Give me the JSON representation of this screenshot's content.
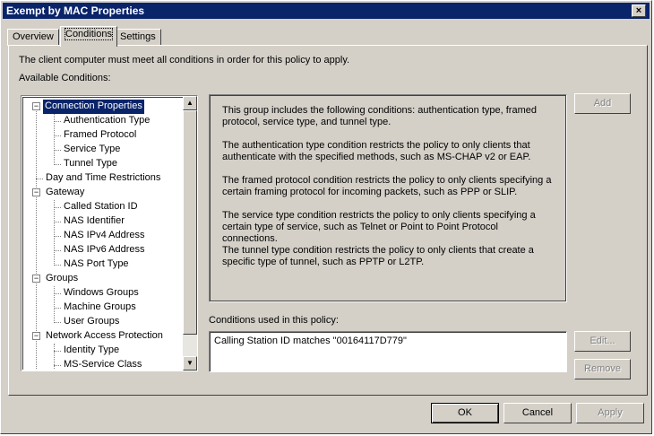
{
  "window": {
    "title": "Exempt by MAC Properties",
    "close_glyph": "×"
  },
  "tabs": [
    {
      "label": "Overview",
      "active": false
    },
    {
      "label": "Conditions",
      "active": true
    },
    {
      "label": "Settings",
      "active": false
    }
  ],
  "intro_text": "The client computer must meet all conditions in order for this policy to apply.",
  "available_label": "Available Conditions:",
  "tree": [
    {
      "label": "Connection Properties",
      "level": 0,
      "expander": "−",
      "selected": true
    },
    {
      "label": "Authentication Type",
      "level": 1
    },
    {
      "label": "Framed Protocol",
      "level": 1
    },
    {
      "label": "Service Type",
      "level": 1
    },
    {
      "label": "Tunnel Type",
      "level": 1
    },
    {
      "label": "Day and Time Restrictions",
      "level": 0
    },
    {
      "label": "Gateway",
      "level": 0,
      "expander": "−"
    },
    {
      "label": "Called Station ID",
      "level": 1
    },
    {
      "label": "NAS Identifier",
      "level": 1
    },
    {
      "label": "NAS IPv4 Address",
      "level": 1
    },
    {
      "label": "NAS IPv6 Address",
      "level": 1
    },
    {
      "label": "NAS Port Type",
      "level": 1
    },
    {
      "label": "Groups",
      "level": 0,
      "expander": "−"
    },
    {
      "label": "Windows Groups",
      "level": 1
    },
    {
      "label": "Machine Groups",
      "level": 1
    },
    {
      "label": "User Groups",
      "level": 1
    },
    {
      "label": "Network Access Protection",
      "level": 0,
      "expander": "−"
    },
    {
      "label": "Identity Type",
      "level": 1
    },
    {
      "label": "MS-Service Class",
      "level": 1
    }
  ],
  "description": [
    "This group includes the following conditions: authentication type, framed protocol, service type, and tunnel type.",
    "The authentication type condition restricts the policy to only clients that authenticate with the specified methods, such as MS-CHAP v2 or EAP.",
    "The framed protocol condition restricts the policy to only clients specifying a certain framing protocol for incoming packets, such as PPP or SLIP.",
    "The service type condition restricts the policy to only clients specifying a certain type of service, such as Telnet or Point to Point Protocol connections.",
    "The tunnel type condition restricts the policy to only clients that create a specific type of tunnel, such as PPTP or L2TP."
  ],
  "buttons": {
    "add": "Add",
    "edit": "Edit...",
    "remove": "Remove",
    "ok": "OK",
    "cancel": "Cancel",
    "apply": "Apply"
  },
  "conditions_label": "Conditions used in this policy:",
  "conditions_used": [
    "Calling Station ID matches \"00164117D779\""
  ],
  "scrollbar": {
    "up_glyph": "▲",
    "down_glyph": "▼"
  },
  "colors": {
    "face": "#d4d0c8",
    "title_bar": "#0a246a",
    "selection": "#0a246a"
  }
}
